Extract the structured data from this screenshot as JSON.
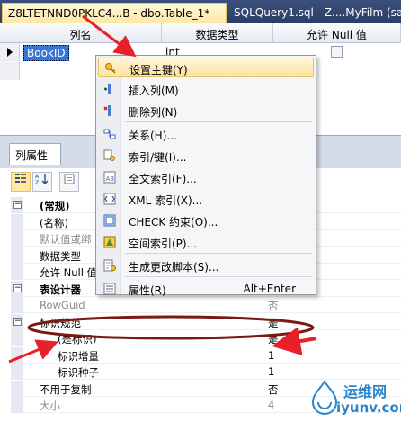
{
  "tabs": [
    {
      "label": "Z8LTETNND0PKLC4...B - dbo.Table_1*",
      "active": true
    },
    {
      "label": "SQLQuery1.sql - Z....MyFilm (sa (",
      "active": false
    }
  ],
  "grid": {
    "headers": [
      "列名",
      "数据类型",
      "允许 Null 值"
    ],
    "rows": [
      {
        "name": "BookID",
        "type": "int",
        "allow_null": false
      }
    ]
  },
  "properties_panel": {
    "tab_label": "列属性",
    "toolbar": [
      "categorized-icon",
      "alphabetical-icon",
      "property-pages-icon"
    ],
    "rows": [
      {
        "name": "(常规)",
        "value": "",
        "kind": "category",
        "expanded": true
      },
      {
        "name": "(名称)",
        "value": "",
        "kind": "prop"
      },
      {
        "name": "默认值或绑",
        "value": "",
        "kind": "prop",
        "gray": true
      },
      {
        "name": "数据类型",
        "value": "",
        "kind": "prop"
      },
      {
        "name": "允许 Null 值",
        "value": "",
        "kind": "prop"
      },
      {
        "name": "表设计器",
        "value": "",
        "kind": "category",
        "expanded": true
      },
      {
        "name": "RowGuid",
        "value": "否",
        "kind": "prop",
        "gray": true
      },
      {
        "name": "标识规范",
        "value": "是",
        "kind": "group",
        "expanded": true
      },
      {
        "name": "(是标识)",
        "value": "是",
        "kind": "sub"
      },
      {
        "name": "标识增量",
        "value": "1",
        "kind": "sub"
      },
      {
        "name": "标识种子",
        "value": "1",
        "kind": "sub"
      },
      {
        "name": "不用于复制",
        "value": "否",
        "kind": "prop"
      },
      {
        "name": "大小",
        "value": "4",
        "kind": "prop",
        "gray": true
      }
    ]
  },
  "context_menu": {
    "items": [
      {
        "label": "设置主键(Y)",
        "icon": "key-icon",
        "shortcut": "",
        "highlight": true
      },
      {
        "label": "插入列(M)",
        "icon": "insert-column-icon",
        "shortcut": ""
      },
      {
        "label": "删除列(N)",
        "icon": "delete-column-icon",
        "shortcut": ""
      },
      {
        "label": "关系(H)...",
        "icon": "relationship-icon",
        "shortcut": ""
      },
      {
        "label": "索引/键(I)...",
        "icon": "index-key-icon",
        "shortcut": ""
      },
      {
        "label": "全文索引(F)...",
        "icon": "fulltext-index-icon",
        "shortcut": ""
      },
      {
        "label": "XML 索引(X)...",
        "icon": "xml-index-icon",
        "shortcut": ""
      },
      {
        "label": "CHECK 约束(O)...",
        "icon": "check-constraint-icon",
        "shortcut": ""
      },
      {
        "label": "空间索引(P)...",
        "icon": "spatial-index-icon",
        "shortcut": ""
      },
      {
        "label": "生成更改脚本(S)...",
        "icon": "generate-script-icon",
        "shortcut": ""
      },
      {
        "label": "属性(R)",
        "icon": "properties-icon",
        "shortcut": "Alt+Enter"
      }
    ]
  },
  "watermark": {
    "cn": "运维网",
    "url": "iyunv.com"
  },
  "colors": {
    "tab_bar": "#2c3e66",
    "selection": "#3875d7",
    "annotation": "#e8202a",
    "watermark": "#2a86c9"
  }
}
